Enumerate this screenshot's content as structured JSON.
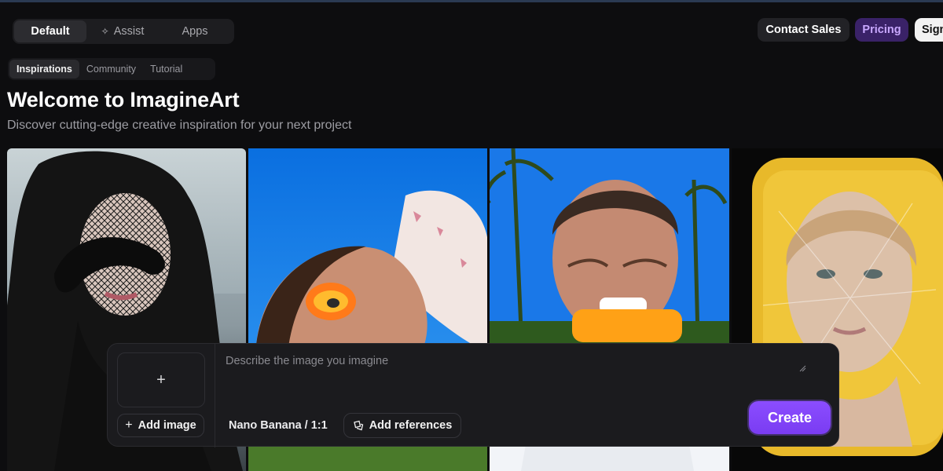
{
  "header": {
    "modes": [
      {
        "label": "Default",
        "icon": "",
        "active": true
      },
      {
        "label": "Assist",
        "icon": "sparkle-icon",
        "active": false
      },
      {
        "label": "Apps",
        "icon": "",
        "active": false
      }
    ],
    "contact_sales_label": "Contact Sales",
    "pricing_label": "Pricing",
    "sign_in_label": "Sign"
  },
  "subtabs": [
    {
      "label": "Inspirations",
      "active": true
    },
    {
      "label": "Community",
      "active": false
    },
    {
      "label": "Tutorial",
      "active": false
    }
  ],
  "main": {
    "title": "Welcome to ImagineArt",
    "subtitle": "Discover cutting-edge creative inspiration for your next project"
  },
  "gallery": {
    "items": [
      {
        "icon": "portrait-woman-snake-image"
      },
      {
        "icon": "portrait-woman-orange-makeup-image"
      },
      {
        "icon": "portrait-man-popsicle-image"
      },
      {
        "icon": "portrait-woman-plastic-wrap-image"
      }
    ]
  },
  "prompt": {
    "placeholder": "Describe the image you imagine",
    "add_image_label": "Add image",
    "model_label": "Nano Banana / 1:1",
    "add_references_label": "Add references",
    "create_label": "Create"
  },
  "colors": {
    "background": "#0d0d0f",
    "accent": "#7a3cf2",
    "pricing_bg": "#3a2268",
    "pricing_text": "#c9a8ff"
  }
}
